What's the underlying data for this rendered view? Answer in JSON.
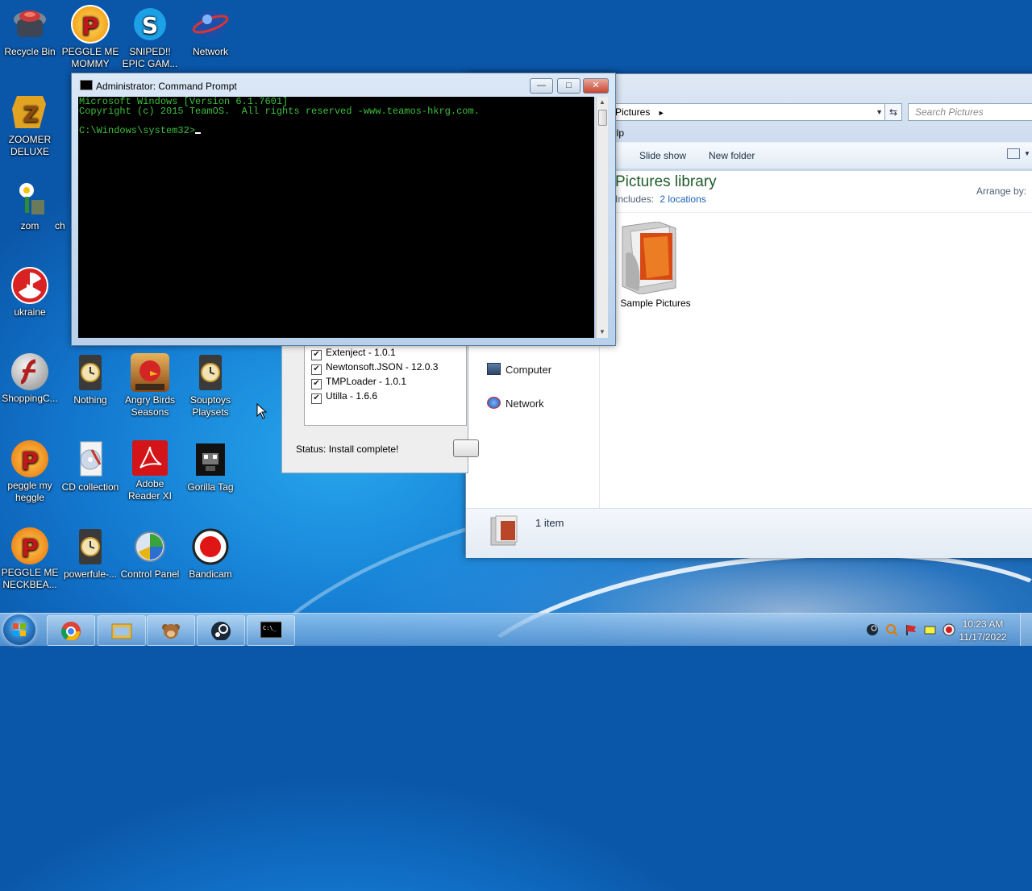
{
  "desktop": {
    "icons": [
      {
        "label": "Recycle Bin",
        "icon": "recycle-bin-icon"
      },
      {
        "label": "PEGGLE ME MOMMY",
        "icon": "peggle-icon"
      },
      {
        "label": "SNIPED!! EPIC GAM...",
        "icon": "skype-icon"
      },
      {
        "label": "Network",
        "icon": "network-icon"
      },
      {
        "label": "ZOOMER DELUXE",
        "icon": "zoomer-icon"
      },
      {
        "label": "zom",
        "icon": "zombie-plant-icon"
      },
      {
        "label": "ch",
        "icon": "shortcut-icon"
      },
      {
        "label": "ukraine",
        "icon": "radiation-icon"
      },
      {
        "label": "ShoppingC...",
        "icon": "flash-icon"
      },
      {
        "label": "Nothing",
        "icon": "clock-doc-icon"
      },
      {
        "label": "Angry Birds Seasons",
        "icon": "angry-birds-icon"
      },
      {
        "label": "Souptoys Playsets",
        "icon": "clock-doc-icon"
      },
      {
        "label": "peggle my heggle",
        "icon": "peggle-icon"
      },
      {
        "label": "CD collection",
        "icon": "cd-icon"
      },
      {
        "label": "Adobe Reader XI",
        "icon": "adobe-reader-icon"
      },
      {
        "label": "Gorilla Tag",
        "icon": "gorilla-icon"
      },
      {
        "label": "PEGGLE ME NECKBEA...",
        "icon": "peggle-icon"
      },
      {
        "label": "powerfule-...",
        "icon": "clock-doc-icon"
      },
      {
        "label": "Control Panel",
        "icon": "control-panel-icon"
      },
      {
        "label": "Bandicam",
        "icon": "bandicam-icon"
      }
    ]
  },
  "cmd": {
    "title": "Administrator: Command Prompt",
    "line1": "Microsoft Windows [Version 6.1.7601]",
    "line2": "Copyright (c) 2015 TeamOS.  All rights reserved -www.teamos-hkrg.com.",
    "prompt": "C:\\Windows\\system32>",
    "btn_min": "—",
    "btn_max": "□",
    "btn_close": "✕",
    "colors": {
      "text": "#3cbf3c",
      "background": "#000000"
    }
  },
  "explorer": {
    "address": "Pictures",
    "address_sep": "►",
    "search_placeholder": "Search Pictures",
    "menu_partial": "elp",
    "commands": {
      "slide_show": "Slide show",
      "new_folder": "New folder"
    },
    "library_title": "Pictures library",
    "includes_label": "Includes:",
    "includes_link": "2 locations",
    "arrange_by": "Arrange by:",
    "nav": [
      {
        "label": "Computer",
        "icon": "computer-icon"
      },
      {
        "label": "Network",
        "icon": "network-icon"
      }
    ],
    "folder": {
      "label": "Sample Pictures",
      "icon": "folder-pictures-icon"
    },
    "status_count": "1 item",
    "colors": {
      "title": "#1e5c2a",
      "link": "#1a62b5"
    }
  },
  "installer": {
    "items": [
      {
        "label": "Extenject - 1.0.1",
        "checked": true
      },
      {
        "label": "Newtonsoft.JSON - 12.0.3",
        "checked": true
      },
      {
        "label": "TMPLoader - 1.0.1",
        "checked": true
      },
      {
        "label": "Utilla - 1.6.6",
        "checked": true
      }
    ],
    "status": "Status: Install complete!"
  },
  "taskbar": {
    "buttons": [
      {
        "name": "chrome",
        "icon": "chrome-icon"
      },
      {
        "name": "explorer",
        "icon": "folder-icon"
      },
      {
        "name": "monkey",
        "icon": "monkey-icon"
      },
      {
        "name": "steam",
        "icon": "steam-icon"
      },
      {
        "name": "command prompt",
        "icon": "cmd-icon"
      }
    ],
    "time": "10:23 AM",
    "date": "11/17/2022"
  }
}
